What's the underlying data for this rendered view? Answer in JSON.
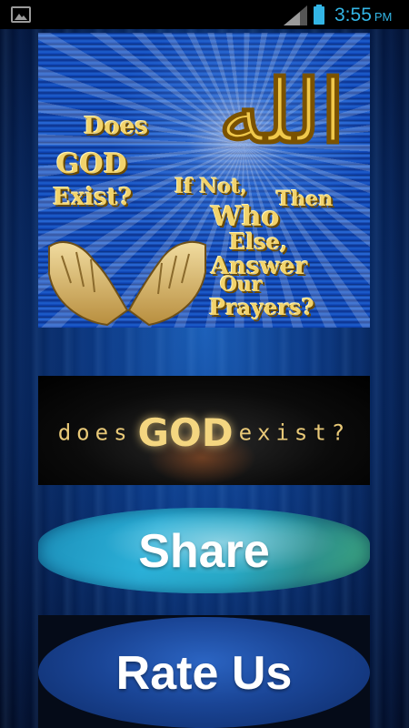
{
  "status_bar": {
    "time": "3:55",
    "ampm": "PM",
    "left_icon": "image-icon",
    "signal_icon": "signal-icon",
    "battery_icon": "battery-icon",
    "accent_color": "#33b5e5"
  },
  "hero": {
    "arabic_calligraphy": "الله",
    "lines": [
      "Does",
      "GOD",
      "Exist?",
      "If Not,",
      "Then",
      "Who",
      "Else,",
      "Answer",
      "Our",
      "Prayers?"
    ]
  },
  "title_banner": {
    "word1": "does",
    "word2": "GOD",
    "word3": "exist?"
  },
  "buttons": {
    "share_label": "Share",
    "rate_label": "Rate Us"
  }
}
